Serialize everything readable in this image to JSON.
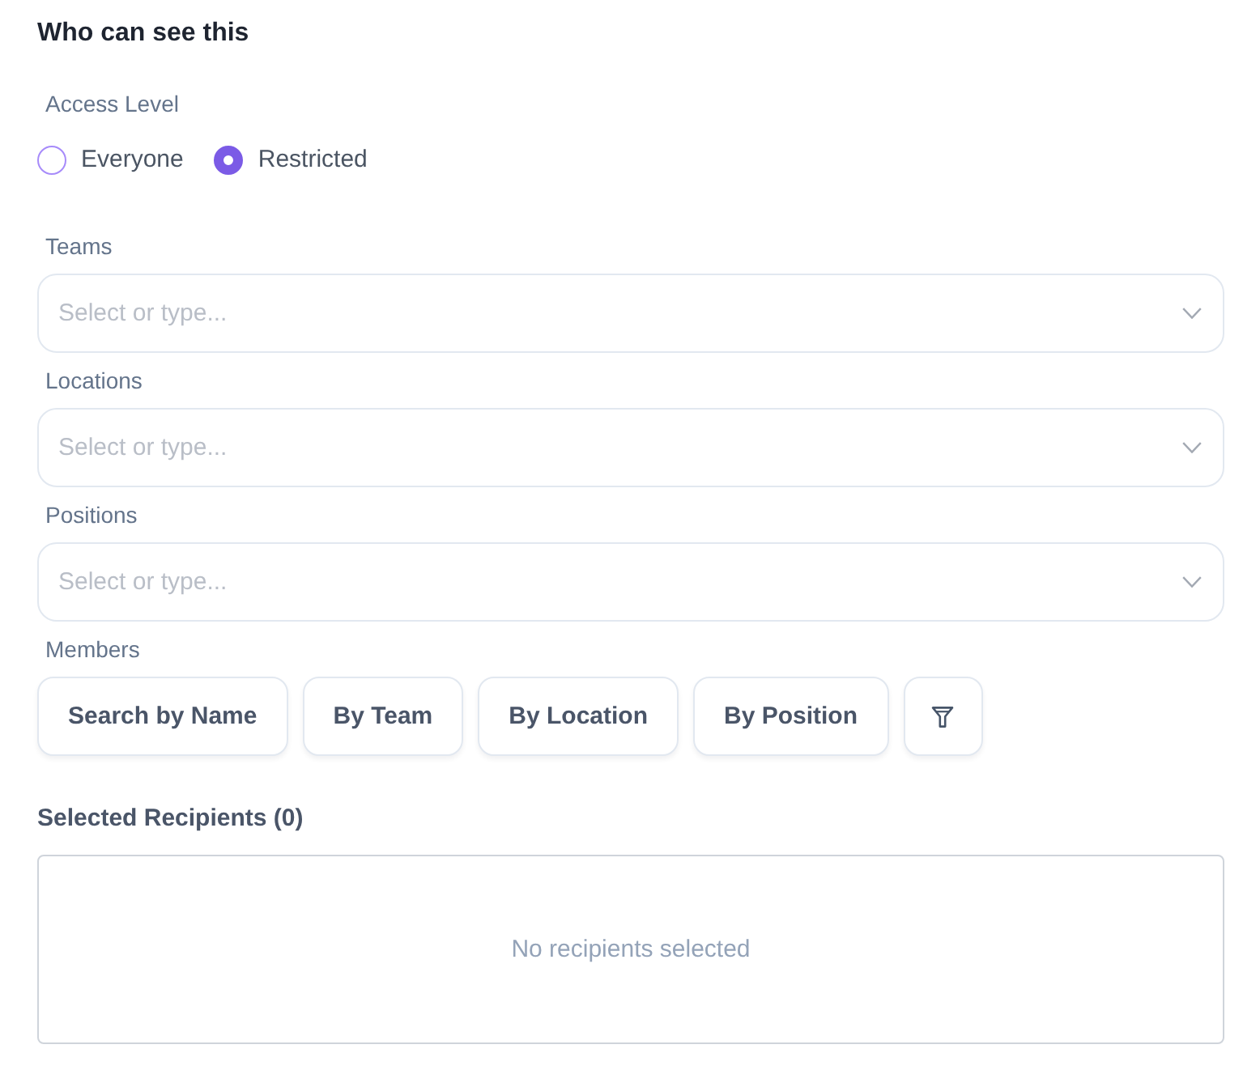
{
  "title": "Who can see this",
  "access_level": {
    "label": "Access Level",
    "options": [
      {
        "label": "Everyone",
        "selected": false
      },
      {
        "label": "Restricted",
        "selected": true
      }
    ]
  },
  "fields": [
    {
      "label": "Teams",
      "placeholder": "Select or type..."
    },
    {
      "label": "Locations",
      "placeholder": "Select or type..."
    },
    {
      "label": "Positions",
      "placeholder": "Select or type..."
    }
  ],
  "members": {
    "label": "Members",
    "buttons": [
      {
        "kind": "text",
        "label": "Search by Name"
      },
      {
        "kind": "text",
        "label": "By Team"
      },
      {
        "kind": "text",
        "label": "By Location"
      },
      {
        "kind": "text",
        "label": "By Position"
      },
      {
        "kind": "filter"
      }
    ]
  },
  "selected_recipients": {
    "title": "Selected Recipients (0)",
    "empty_text": "No recipients selected"
  }
}
